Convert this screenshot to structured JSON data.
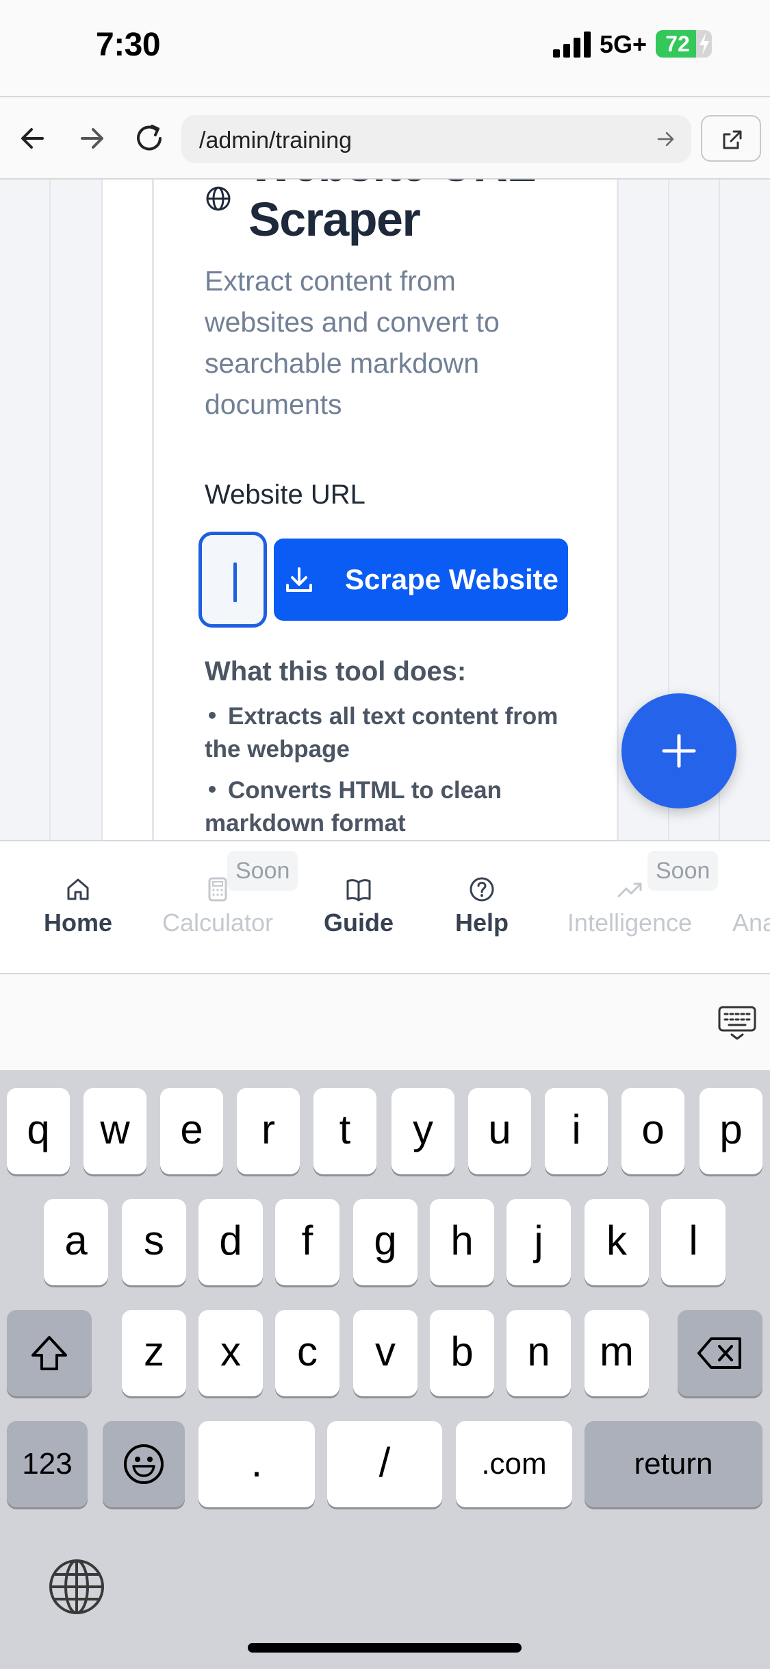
{
  "status_bar": {
    "time": "7:30",
    "network": "5G+",
    "battery": "72"
  },
  "browser": {
    "address": "/admin/training"
  },
  "tool": {
    "title_top": "Website URL",
    "title": "Scraper",
    "description": "Extract content from websites and convert to searchable markdown documents",
    "field_label": "Website URL",
    "input_value": "",
    "button_label": "Scrape Website",
    "section_heading": "What this tool does:",
    "bullets": [
      "Extracts all text content from the webpage",
      "Converts HTML to clean markdown format"
    ]
  },
  "nav": {
    "items": [
      {
        "label": "Home",
        "icon": "home-icon",
        "enabled": true
      },
      {
        "label": "Calculator",
        "icon": "calculator-icon",
        "enabled": false,
        "badge": "Soon"
      },
      {
        "label": "Guide",
        "icon": "book-icon",
        "enabled": true
      },
      {
        "label": "Help",
        "icon": "help-circle-icon",
        "enabled": true
      },
      {
        "label": "Intelligence",
        "icon": "trending-up-icon",
        "enabled": false,
        "badge": "Soon"
      },
      {
        "label": "Ana",
        "icon": "",
        "enabled": false
      }
    ]
  },
  "keyboard": {
    "row1": [
      "q",
      "w",
      "e",
      "r",
      "t",
      "y",
      "u",
      "i",
      "o",
      "p"
    ],
    "row2": [
      "a",
      "s",
      "d",
      "f",
      "g",
      "h",
      "j",
      "k",
      "l"
    ],
    "row3": [
      "z",
      "x",
      "c",
      "v",
      "b",
      "n",
      "m"
    ],
    "row4": {
      "numbers": "123",
      "dot": ".",
      "slash": "/",
      "com": ".com",
      "return": "return"
    }
  },
  "colors": {
    "primary": "#0a5cf5",
    "fab": "#2563eb",
    "battery": "#34c759"
  }
}
